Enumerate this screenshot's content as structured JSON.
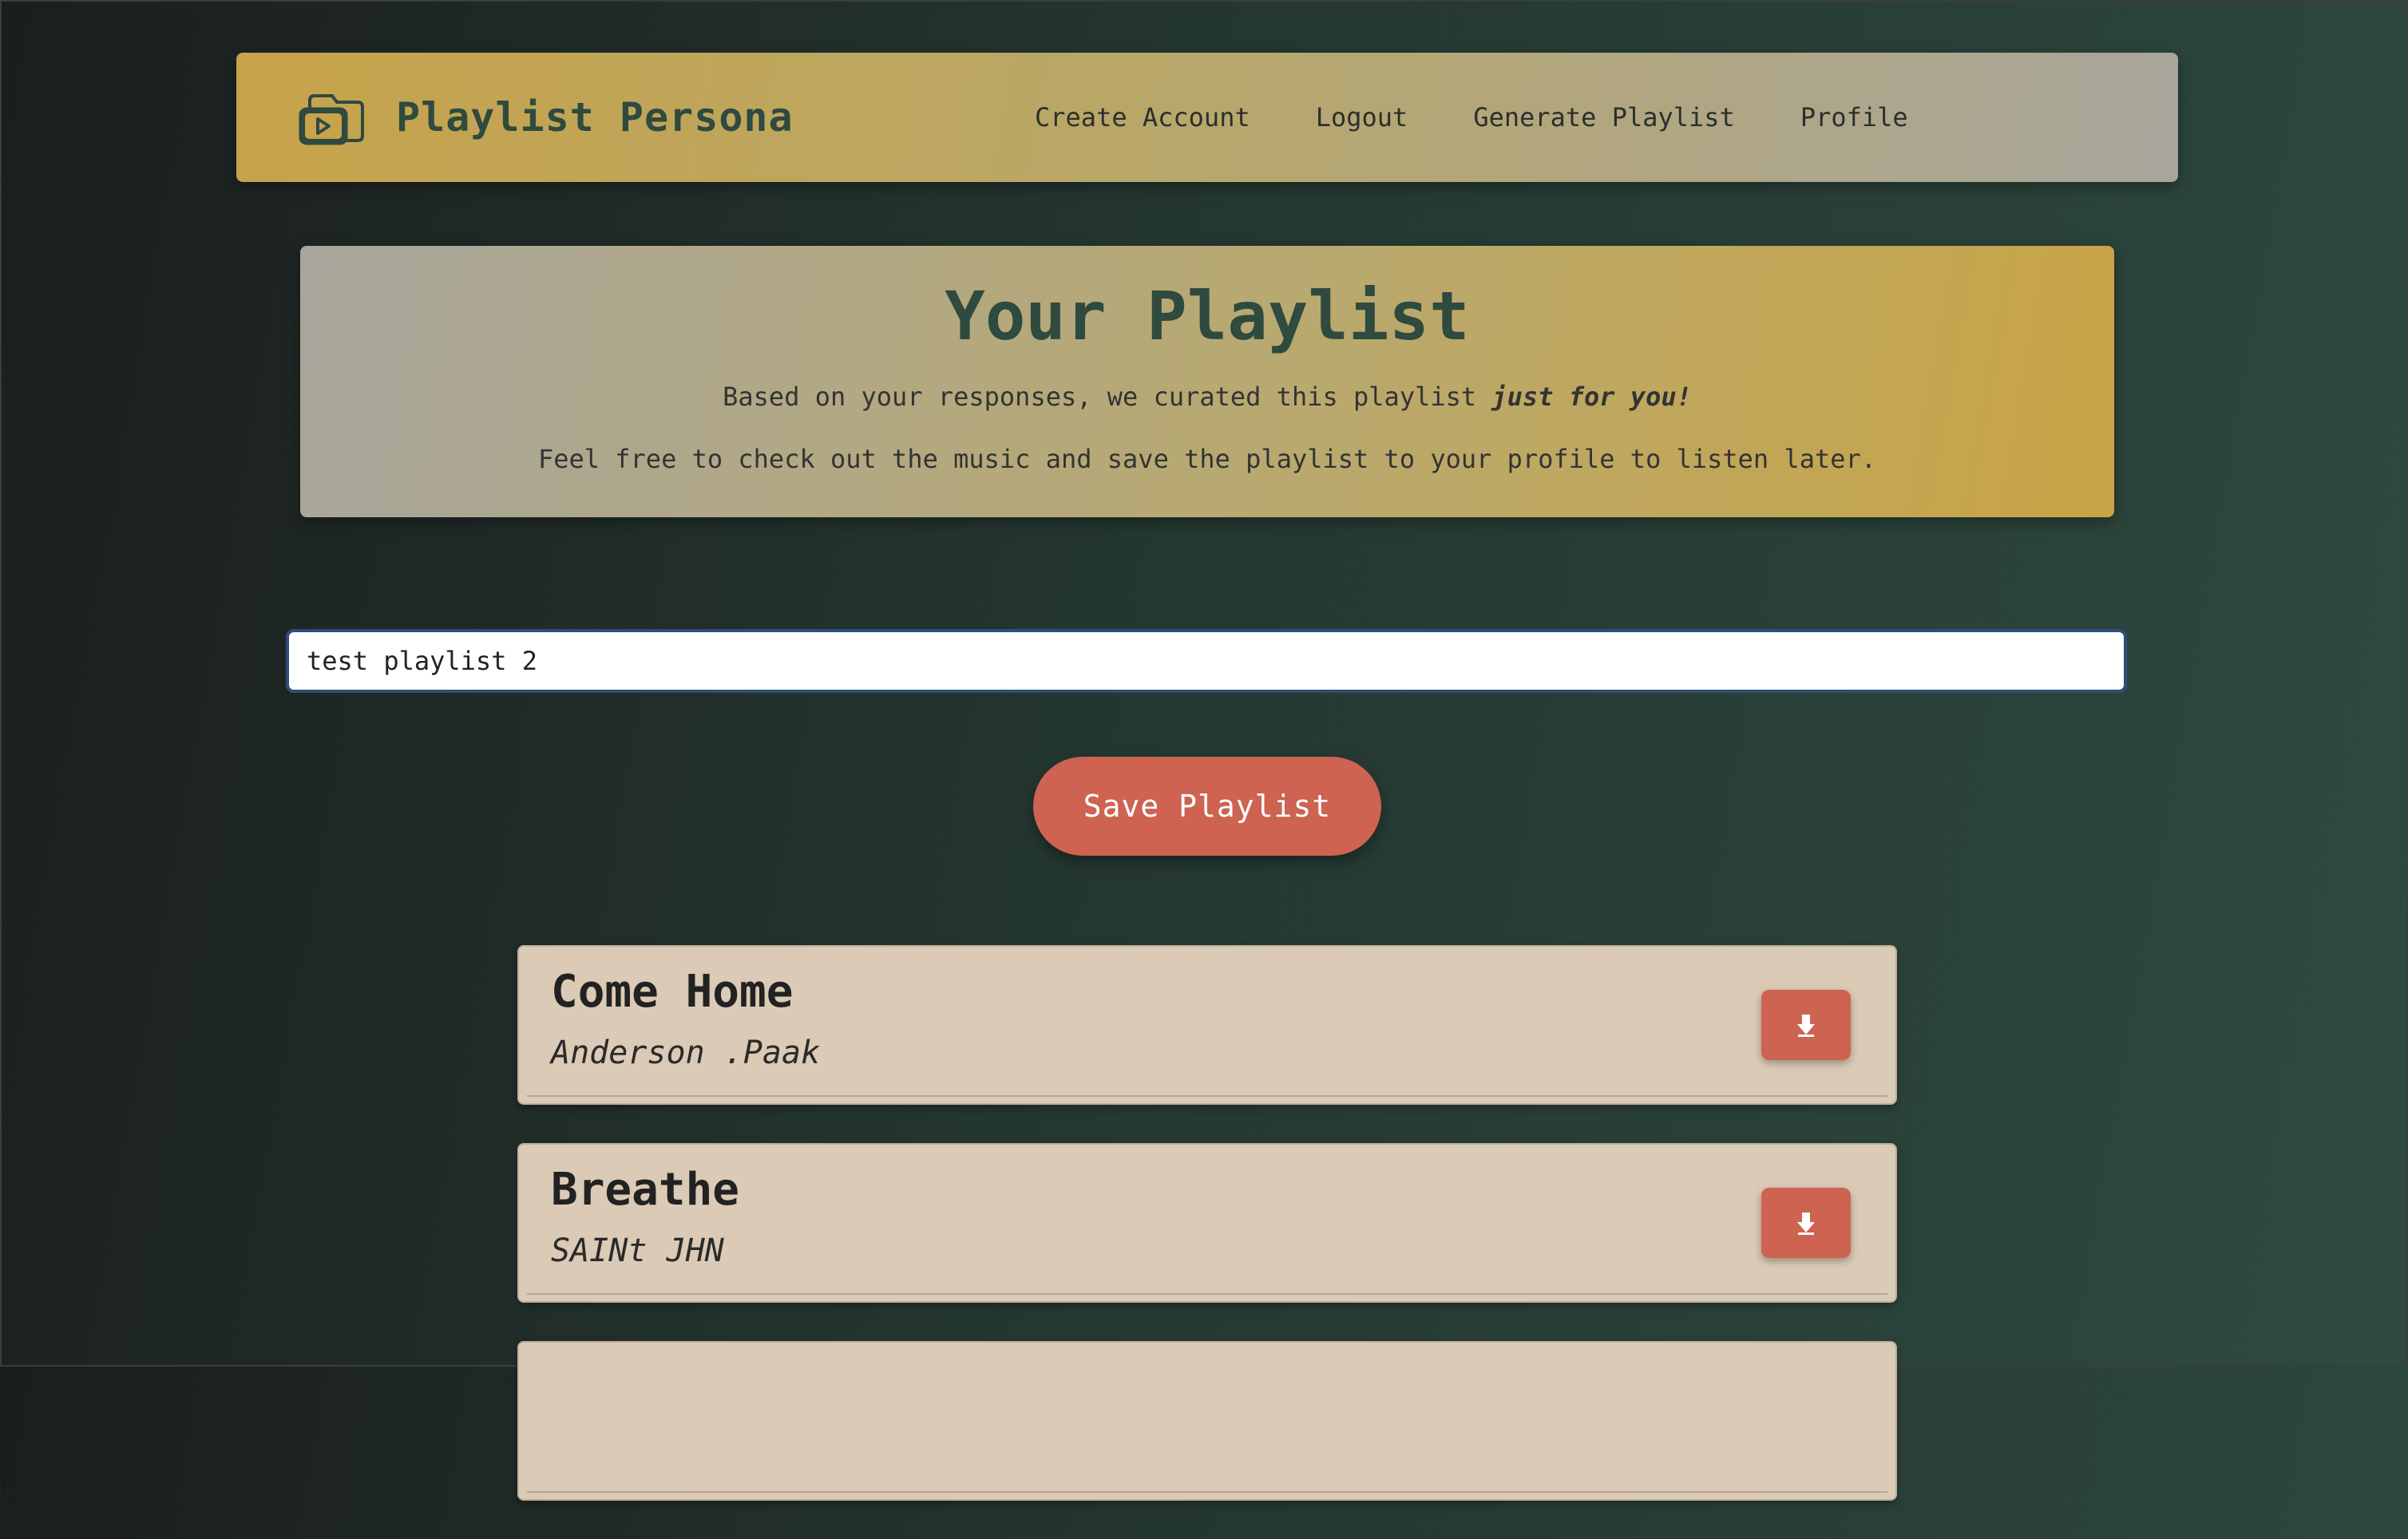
{
  "navbar": {
    "brand_name": "Playlist Persona",
    "brand_icon": "music-folder-play-icon",
    "links": [
      {
        "label": "Create Account"
      },
      {
        "label": "Logout"
      },
      {
        "label": "Generate Playlist"
      },
      {
        "label": "Profile"
      }
    ]
  },
  "hero": {
    "title": "Your Playlist",
    "line1_prefix": "Based on your responses, we curated this playlist ",
    "line1_emphasis": "just for you!",
    "line2": "Feel free to check out the music and save the playlist to your profile to listen later."
  },
  "playlist_name_input": {
    "value": "test playlist 2"
  },
  "save_button": {
    "label": "Save Playlist"
  },
  "songs": [
    {
      "title": "Come Home",
      "artist": "Anderson .Paak",
      "action_icon": "download-arrow-icon"
    },
    {
      "title": "Breathe",
      "artist": "SAINt JHN",
      "action_icon": "download-arrow-icon"
    }
  ],
  "colors": {
    "accent_gold": "#c7a34a",
    "accent_green": "#2f4a3f",
    "button_coral": "#cd6350",
    "card_beige": "#dbcab5"
  }
}
